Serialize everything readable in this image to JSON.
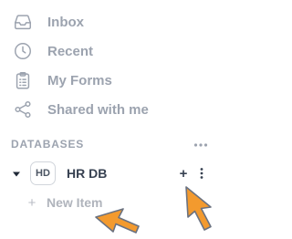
{
  "nav": {
    "items": [
      {
        "label": "Inbox",
        "icon": "inbox-icon"
      },
      {
        "label": "Recent",
        "icon": "clock-icon"
      },
      {
        "label": "My Forms",
        "icon": "clipboard-icon"
      },
      {
        "label": "Shared with me",
        "icon": "share-icon"
      }
    ]
  },
  "databases": {
    "header": "DATABASES",
    "more_label": "•••",
    "items": [
      {
        "badge": "HD",
        "name": "HR DB",
        "add_label": "+",
        "new_item_label": "New Item",
        "new_item_plus": "+"
      }
    ]
  },
  "colors": {
    "muted_text": "#9ca3af",
    "strong_text": "#374151",
    "cursor_fill": "#f39a2e",
    "cursor_stroke": "#6b7280"
  }
}
